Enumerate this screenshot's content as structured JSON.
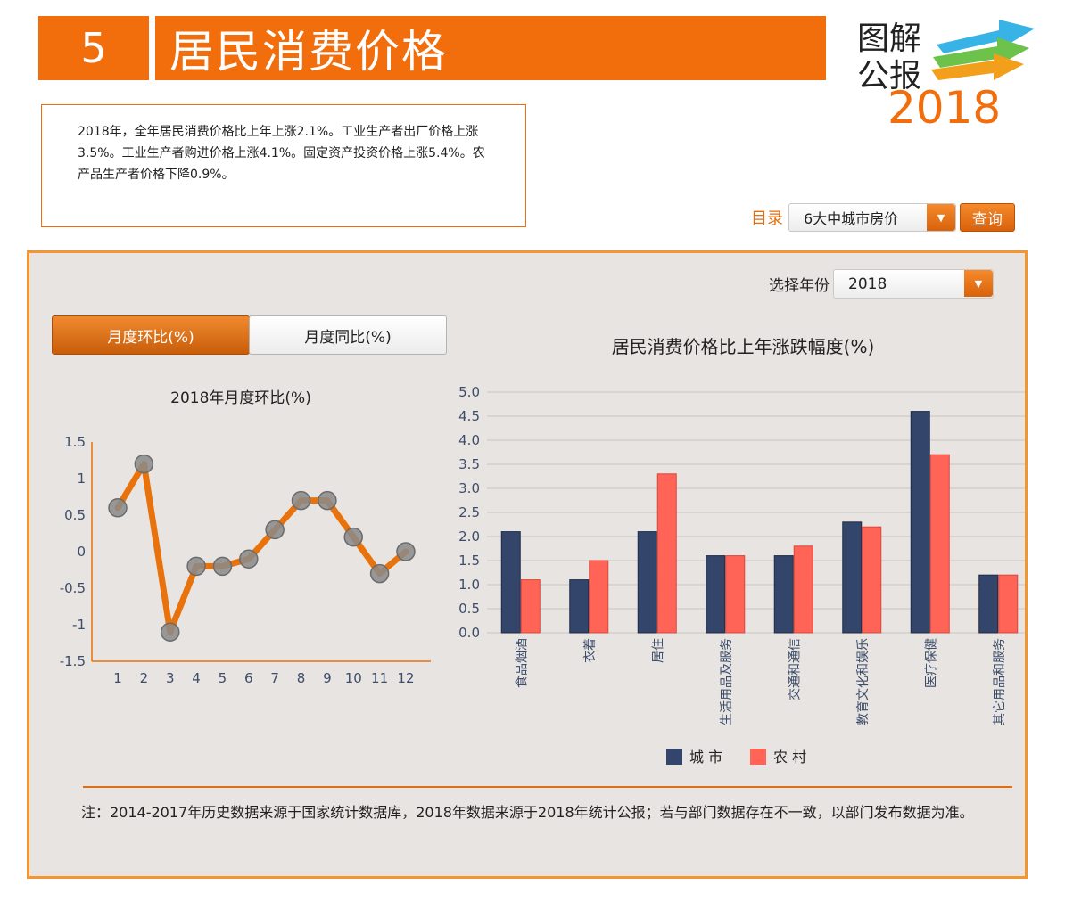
{
  "header": {
    "number": "5",
    "title": "居民消费价格"
  },
  "logo": {
    "line1": "图解",
    "line2": "公报",
    "year": "2018"
  },
  "summary": "2018年，全年居民消费价格比上年上涨2.1%。工业生产者出厂价格上涨3.5%。工业生产者购进价格上涨4.1%。固定资产投资价格上涨5.4%。农产品生产者价格下降0.9%。",
  "toc": {
    "label": "目录",
    "selected": "6大中城市房价",
    "query_label": "查询"
  },
  "year_selector": {
    "label": "选择年份",
    "selected": "2018"
  },
  "tabs": [
    {
      "label": "月度环比(%)",
      "active": true
    },
    {
      "label": "月度同比(%)",
      "active": false
    }
  ],
  "colors": {
    "accent": "#f26d0b",
    "line": "#e8720c",
    "urban": "#33456a",
    "rural": "#ff6456"
  },
  "chart_data": [
    {
      "type": "line",
      "title": "2018年月度环比(%)",
      "x": [
        "1",
        "2",
        "3",
        "4",
        "5",
        "6",
        "7",
        "8",
        "9",
        "10",
        "11",
        "12"
      ],
      "series": [
        {
          "values": [
            0.6,
            1.2,
            -1.1,
            -0.2,
            -0.2,
            -0.1,
            0.3,
            0.7,
            0.7,
            0.2,
            -0.3,
            0.0
          ]
        }
      ],
      "ylim": [
        -1.5,
        1.5
      ],
      "yticks": [
        "1.5",
        "1",
        "0.5",
        "0",
        "-0.5",
        "-1",
        "-1.5"
      ],
      "grid": false
    },
    {
      "type": "bar",
      "title": "居民消费价格比上年涨跌幅度(%)",
      "categories": [
        "食品烟酒",
        "衣着",
        "居住",
        "生活用品及服务",
        "交通和通信",
        "教育文化和娱乐",
        "医疗保健",
        "其它用品和服务"
      ],
      "series": [
        {
          "name": "城  市",
          "values": [
            2.1,
            1.1,
            2.1,
            1.6,
            1.6,
            2.3,
            4.6,
            1.2
          ]
        },
        {
          "name": "农  村",
          "values": [
            1.1,
            1.5,
            3.3,
            1.6,
            1.8,
            2.2,
            3.7,
            1.2
          ]
        }
      ],
      "ylim": [
        0,
        5
      ],
      "yticks": [
        "5.0",
        "4.5",
        "4.0",
        "3.5",
        "3.0",
        "2.5",
        "2.0",
        "1.5",
        "1.0",
        "0.5",
        "0.0"
      ],
      "grid": true,
      "legend": "bottom"
    }
  ],
  "note": "注：2014-2017年历史数据来源于国家统计数据库，2018年数据来源于2018年统计公报；若与部门数据存在不一致，以部门发布数据为准。"
}
